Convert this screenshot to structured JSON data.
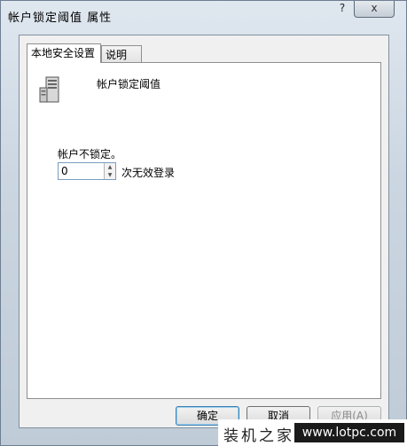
{
  "window": {
    "title": "帐户锁定阈值 属性",
    "help_glyph": "?",
    "close_glyph": "x"
  },
  "tabs": [
    {
      "label": "本地安全设置",
      "active": true
    },
    {
      "label": "说明",
      "active": false
    }
  ],
  "policy": {
    "name": "帐户锁定阈值",
    "icon": "server-icon"
  },
  "setting": {
    "status_label": "帐户不锁定。",
    "value": "0",
    "suffix": "次无效登录"
  },
  "buttons": {
    "ok": "确定",
    "cancel": "取消",
    "apply": "应用(A)"
  },
  "watermark": {
    "brand": "装机之家",
    "url": "www.lotpc.com"
  }
}
